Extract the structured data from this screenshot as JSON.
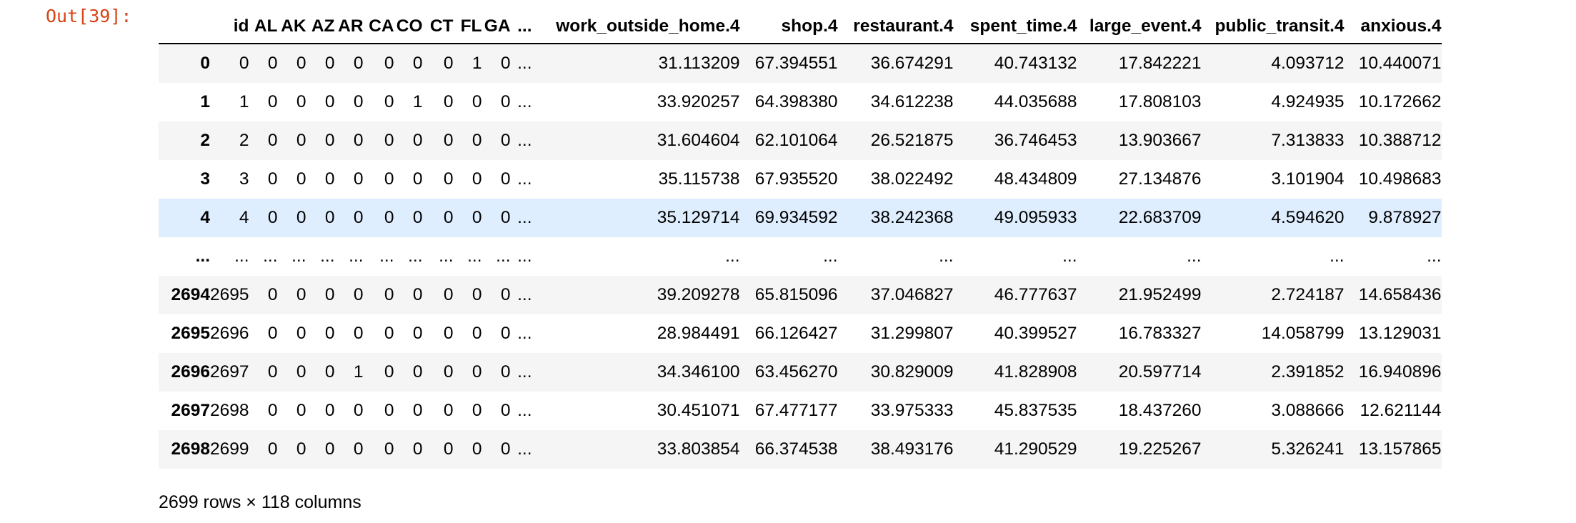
{
  "prompt": "Out[39]:",
  "columns": [
    "id",
    "AL",
    "AK",
    "AZ",
    "AR",
    "CA",
    "CO",
    "CT",
    "FL",
    "GA",
    "...",
    "work_outside_home.4",
    "shop.4",
    "restaurant.4",
    "spent_time.4",
    "large_event.4",
    "public_transit.4",
    "anxious.4"
  ],
  "rows": [
    {
      "index": "0",
      "values": [
        "0",
        "0",
        "0",
        "0",
        "0",
        "0",
        "0",
        "0",
        "1",
        "0",
        "...",
        "31.113209",
        "67.394551",
        "36.674291",
        "40.743132",
        "17.842221",
        "4.093712",
        "10.440071"
      ]
    },
    {
      "index": "1",
      "values": [
        "1",
        "0",
        "0",
        "0",
        "0",
        "0",
        "1",
        "0",
        "0",
        "0",
        "...",
        "33.920257",
        "64.398380",
        "34.612238",
        "44.035688",
        "17.808103",
        "4.924935",
        "10.172662"
      ]
    },
    {
      "index": "2",
      "values": [
        "2",
        "0",
        "0",
        "0",
        "0",
        "0",
        "0",
        "0",
        "0",
        "0",
        "...",
        "31.604604",
        "62.101064",
        "26.521875",
        "36.746453",
        "13.903667",
        "7.313833",
        "10.388712"
      ]
    },
    {
      "index": "3",
      "values": [
        "3",
        "0",
        "0",
        "0",
        "0",
        "0",
        "0",
        "0",
        "0",
        "0",
        "...",
        "35.115738",
        "67.935520",
        "38.022492",
        "48.434809",
        "27.134876",
        "3.101904",
        "10.498683"
      ]
    },
    {
      "index": "4",
      "values": [
        "4",
        "0",
        "0",
        "0",
        "0",
        "0",
        "0",
        "0",
        "0",
        "0",
        "...",
        "35.129714",
        "69.934592",
        "38.242368",
        "49.095933",
        "22.683709",
        "4.594620",
        "9.878927"
      ]
    },
    {
      "index": "...",
      "values": [
        "...",
        "...",
        "...",
        "...",
        "...",
        "...",
        "...",
        "...",
        "...",
        "...",
        "...",
        "...",
        "...",
        "...",
        "...",
        "...",
        "...",
        "..."
      ]
    },
    {
      "index": "2694",
      "values": [
        "2695",
        "0",
        "0",
        "0",
        "0",
        "0",
        "0",
        "0",
        "0",
        "0",
        "...",
        "39.209278",
        "65.815096",
        "37.046827",
        "46.777637",
        "21.952499",
        "2.724187",
        "14.658436"
      ]
    },
    {
      "index": "2695",
      "values": [
        "2696",
        "0",
        "0",
        "0",
        "0",
        "0",
        "0",
        "0",
        "0",
        "0",
        "...",
        "28.984491",
        "66.126427",
        "31.299807",
        "40.399527",
        "16.783327",
        "14.058799",
        "13.129031"
      ]
    },
    {
      "index": "2696",
      "values": [
        "2697",
        "0",
        "0",
        "0",
        "1",
        "0",
        "0",
        "0",
        "0",
        "0",
        "...",
        "34.346100",
        "63.456270",
        "30.829009",
        "41.828908",
        "20.597714",
        "2.391852",
        "16.940896"
      ]
    },
    {
      "index": "2697",
      "values": [
        "2698",
        "0",
        "0",
        "0",
        "0",
        "0",
        "0",
        "0",
        "0",
        "0",
        "...",
        "30.451071",
        "67.477177",
        "33.975333",
        "45.837535",
        "18.437260",
        "3.088666",
        "12.621144"
      ]
    },
    {
      "index": "2698",
      "values": [
        "2699",
        "0",
        "0",
        "0",
        "0",
        "0",
        "0",
        "0",
        "0",
        "0",
        "...",
        "33.803854",
        "66.374538",
        "38.493176",
        "41.290529",
        "19.225267",
        "5.326241",
        "13.157865"
      ]
    }
  ],
  "hovered_row": 4,
  "shape_text": "2699 rows × 118 columns"
}
